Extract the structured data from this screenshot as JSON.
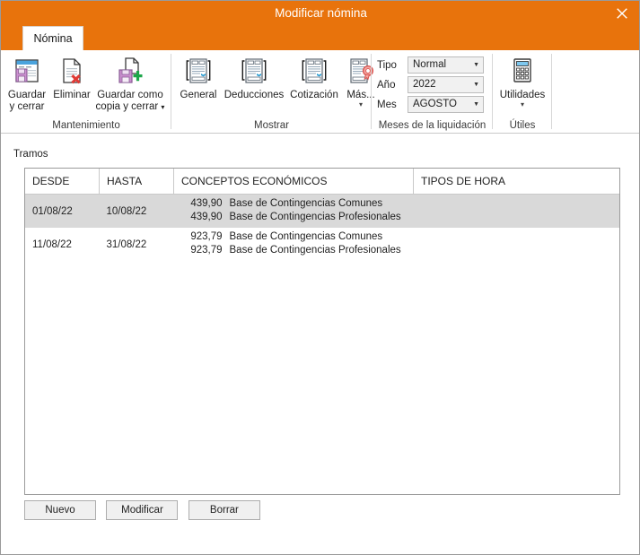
{
  "window": {
    "title": "Modificar nómina",
    "close_label": "✕",
    "accent_color": "#E8730C"
  },
  "tabs": [
    {
      "label": "Nómina",
      "active": true
    }
  ],
  "ribbon": {
    "groups": [
      {
        "name": "mantenimiento",
        "label": "Mantenimiento",
        "buttons": [
          {
            "name": "guardar-y-cerrar",
            "label_line1": "Guardar",
            "label_line2": "y cerrar",
            "icon": "save-window-icon",
            "has_caret": false
          },
          {
            "name": "eliminar",
            "label_line1": "Eliminar",
            "label_line2": "",
            "icon": "document-delete-icon",
            "has_caret": false
          },
          {
            "name": "guardar-como-copia-y-cerrar",
            "label_line1": "Guardar como",
            "label_line2": "copia y cerrar",
            "icon": "save-copy-icon",
            "has_caret": true
          }
        ]
      },
      {
        "name": "mostrar",
        "label": "Mostrar",
        "buttons": [
          {
            "name": "general",
            "label_line1": "General",
            "label_line2": "",
            "icon": "document-brackets-icon",
            "has_caret": false
          },
          {
            "name": "deducciones",
            "label_line1": "Deducciones",
            "label_line2": "",
            "icon": "document-brackets-icon",
            "has_caret": false
          },
          {
            "name": "cotizacion",
            "label_line1": "Cotización",
            "label_line2": "",
            "icon": "document-brackets-icon",
            "has_caret": false
          },
          {
            "name": "mas",
            "label_line1": "Más...",
            "label_line2": "",
            "icon": "document-seal-icon",
            "has_caret": true
          }
        ]
      },
      {
        "name": "meses-de-la-liquidacion",
        "label": "Meses de la liquidación",
        "fields": [
          {
            "name": "tipo",
            "label": "Tipo",
            "value": "Normal"
          },
          {
            "name": "ano",
            "label": "Año",
            "value": "2022"
          },
          {
            "name": "mes",
            "label": "Mes",
            "value": "AGOSTO"
          }
        ]
      },
      {
        "name": "utiles",
        "label": "Útiles",
        "buttons": [
          {
            "name": "utilidades",
            "label_line1": "Utilidades",
            "label_line2": "",
            "icon": "calculator-icon",
            "has_caret": true
          }
        ]
      }
    ]
  },
  "main": {
    "section_label": "Tramos",
    "table": {
      "columns": [
        "DESDE",
        "HASTA",
        "CONCEPTOS ECONÓMICOS",
        "TIPOS DE HORA"
      ],
      "rows": [
        {
          "selected": true,
          "desde": "01/08/22",
          "hasta": "10/08/22",
          "conceptos": [
            {
              "amount": "439,90",
              "name": "Base de Contingencias Comunes"
            },
            {
              "amount": "439,90",
              "name": "Base de Contingencias Profesionales"
            }
          ],
          "tipos_de_hora": ""
        },
        {
          "selected": false,
          "desde": "11/08/22",
          "hasta": "31/08/22",
          "conceptos": [
            {
              "amount": "923,79",
              "name": "Base de Contingencias Comunes"
            },
            {
              "amount": "923,79",
              "name": "Base de Contingencias Profesionales"
            }
          ],
          "tipos_de_hora": ""
        }
      ]
    },
    "buttons": [
      {
        "name": "nuevo",
        "label": "Nuevo"
      },
      {
        "name": "modificar",
        "label": "Modificar"
      },
      {
        "name": "borrar",
        "label": "Borrar"
      }
    ]
  }
}
